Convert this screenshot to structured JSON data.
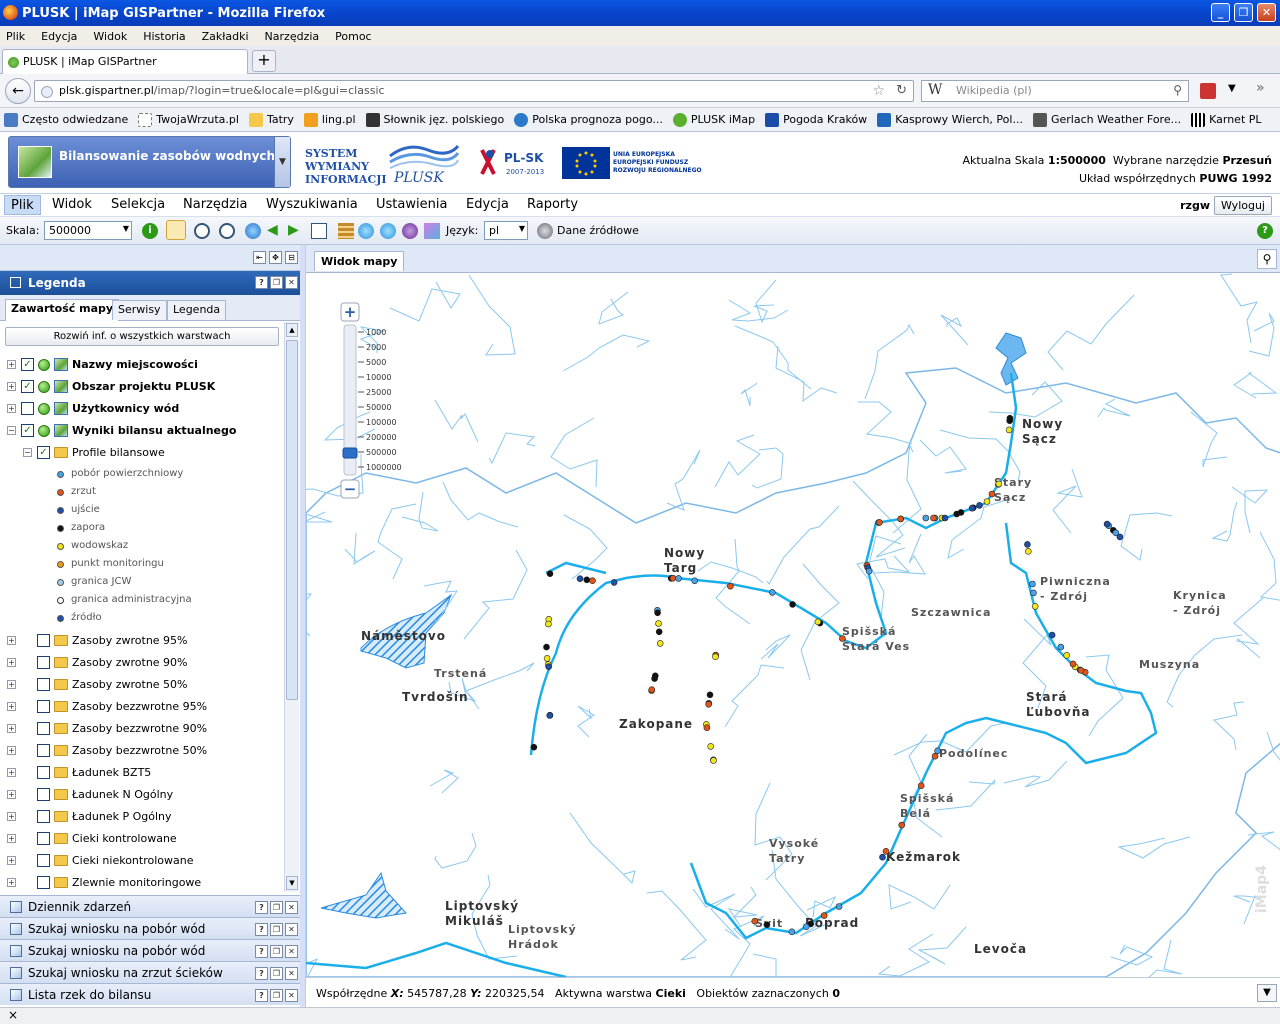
{
  "window": {
    "title": "PLUSK | iMap GISPartner - Mozilla Firefox"
  },
  "browser": {
    "menu": [
      "Plik",
      "Edycja",
      "Widok",
      "Historia",
      "Zakładki",
      "Narzędzia",
      "Pomoc"
    ],
    "tab_title": "PLUSK | iMap GISPartner",
    "url_host": "plsk.gispartner.pl",
    "url_path": "/imap/?login=true&locale=pl&gui=classic",
    "search_placeholder": "Wikipedia (pl)",
    "bookmarks": [
      "Często odwiedzane",
      "TwojaWrzuta.pl",
      "Tatry",
      "ling.pl",
      "Słownik jęz. polskiego",
      "Polska prognoza pogo...",
      "PLUSK iMap",
      "Pogoda Kraków",
      "Kasprowy Wierch, Pol...",
      "Gerlach Weather Fore...",
      "Karnet PL"
    ]
  },
  "header": {
    "app_button": "Bilansowanie zasobów wodnych",
    "system_lines": [
      "SYSTEM",
      "WYMIANY",
      "INFORMACJI"
    ],
    "plusk_logo": "PLUSK",
    "plsk_logo": "PL-SK",
    "plsk_years": "2007-2013",
    "eu_lines": [
      "UNIA EUROPEJSKA",
      "EUROPEJSKI FUNDUSZ",
      "ROZWOJU REGIONALNEGO"
    ],
    "scale_label": "Aktualna Skala",
    "scale_value": "1:500000",
    "tool_label": "Wybrane narzędzie",
    "tool_value": "Przesuń",
    "crs_label": "Układ współrzędnych",
    "crs_value": "PUWG 1992"
  },
  "app_menu": [
    "Plik",
    "Widok",
    "Selekcja",
    "Narzędzia",
    "Wyszukiwania",
    "Ustawienia",
    "Edycja",
    "Raporty"
  ],
  "user": "rzgw",
  "logout": "Wyloguj",
  "toolbar": {
    "scale_label": "Skala:",
    "scale_value": "500000",
    "lang_label": "Język:",
    "lang_value": "pl",
    "source_label": "Dane źródłowe"
  },
  "legend": {
    "title": "Legenda",
    "tabs": [
      "Zawartość mapy",
      "Serwisy",
      "Legenda"
    ],
    "expand_all": "Rozwiń inf. o wszystkich warstwach",
    "layers": [
      {
        "label": "Nazwy miejscowości",
        "checked": true,
        "bold": true
      },
      {
        "label": "Obszar projektu PLUSK",
        "checked": true,
        "bold": true
      },
      {
        "label": "Użytkownicy wód",
        "checked": false,
        "bold": true
      },
      {
        "label": "Wyniki bilansu aktualnego",
        "checked": true,
        "bold": true
      }
    ],
    "profile_group": "Profile bilansowe",
    "symbols": [
      {
        "label": "pobór powierzchniowy",
        "color": "#4aa3e8"
      },
      {
        "label": "zrzut",
        "color": "#e0561a"
      },
      {
        "label": "ujście",
        "color": "#1f4fa8"
      },
      {
        "label": "zapora",
        "color": "#111111"
      },
      {
        "label": "wodowskaz",
        "color": "#f2e51c"
      },
      {
        "label": "punkt monitoringu",
        "color": "#f09a1a"
      },
      {
        "label": "granica JCW",
        "color": "#9ecbee"
      },
      {
        "label": "granica administracyjna",
        "color": "#ffffff"
      },
      {
        "label": "źródło",
        "color": "#1f4fa8"
      }
    ],
    "folders": [
      "Zasoby zwrotne 95%",
      "Zasoby zwrotne 90%",
      "Zasoby zwrotne 50%",
      "Zasoby bezzwrotne 95%",
      "Zasoby bezzwrotne 90%",
      "Zasoby bezzwrotne 50%",
      "Ładunek BZT5",
      "Ładunek N Ogólny",
      "Ładunek P Ogólny",
      "Cieki kontrolowane",
      "Cieki niekontrolowane",
      "Zlewnie monitoringowe"
    ]
  },
  "sections": [
    "Dziennik zdarzeń",
    "Szukaj wniosku na pobór wód",
    "Szukaj wniosku na pobór wód",
    "Szukaj wniosku na zrzut ścieków",
    "Lista rzek do bilansu"
  ],
  "map": {
    "tab": "Widok mapy",
    "zoom_scales": [
      "1000",
      "2000",
      "5000",
      "10000",
      "25000",
      "50000",
      "100000",
      "200000",
      "500000",
      "1000000"
    ],
    "places": [
      "Nowy Sącz",
      "Stary Sącz",
      "Nowy Targ",
      "Náměstovo",
      "Trstená",
      "Tvrdošín",
      "Zakopane",
      "Szczawnica",
      "Spišská Stará Ves",
      "Piwniczna - Zdrój",
      "Krynica - Zdrój",
      "Muszyna",
      "Stará Ľubovňa",
      "Podolínec",
      "Spišská Belá",
      "Kežmarok",
      "Vysoké Tatry",
      "Svit",
      "Poprad",
      "Liptovský Mikuláš",
      "Liptovský Hrádok",
      "Levoča"
    ],
    "watermark": "iMap4"
  },
  "status": {
    "coords_label": "Współrzędne",
    "x_label": "X:",
    "x_value": "545787,28",
    "y_label": "Y:",
    "y_value": "220325,54",
    "active_label": "Aktywna warstwa",
    "active_value": "Cieki",
    "selected_label": "Obiektów zaznaczonych",
    "selected_value": "0"
  },
  "browser_status": "×"
}
